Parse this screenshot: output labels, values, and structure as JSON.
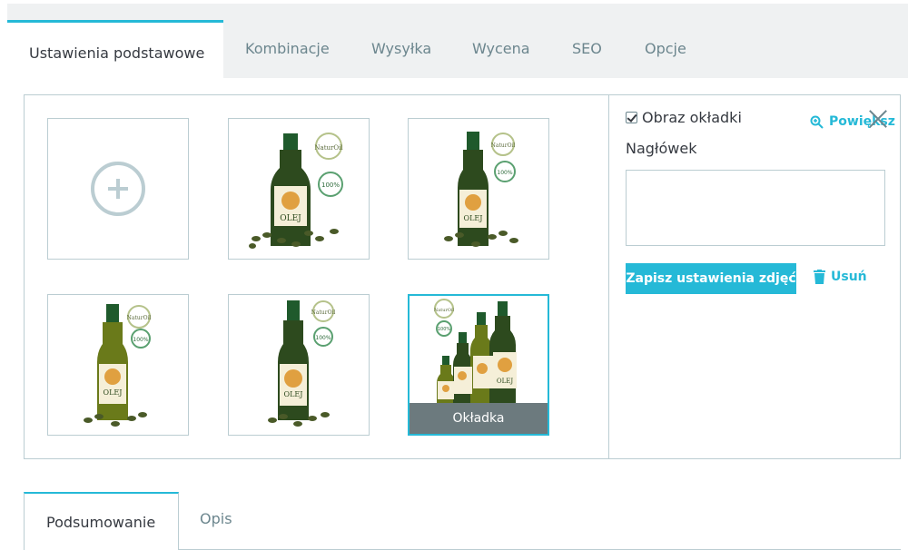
{
  "tabs": {
    "items": [
      {
        "label": "Ustawienia podstawowe",
        "active": true
      },
      {
        "label": "Kombinacje"
      },
      {
        "label": "Wysyłka"
      },
      {
        "label": "Wycena"
      },
      {
        "label": "SEO"
      },
      {
        "label": "Opcje"
      }
    ]
  },
  "images": {
    "add_icon": "plus-circle-icon",
    "cover_label": "Okładka",
    "items": [
      {
        "brand": "NaturOil",
        "badge": "100%",
        "product": "OLEJ"
      },
      {
        "brand": "NaturOil",
        "badge": "100%",
        "product": "OLEJ"
      },
      {
        "brand": "NaturOil",
        "badge": "100%",
        "product": "OLEJ"
      },
      {
        "brand": "NaturOil",
        "badge": "100%",
        "product": "OLEJ"
      },
      {
        "brand": "NaturOil",
        "badge": "100%",
        "product": "OLEJ",
        "cover": true
      }
    ]
  },
  "settings": {
    "cover_checkbox_label": "Obraz okładki",
    "cover_checked": true,
    "zoom_label": "Powiększ",
    "caption_label": "Nagłówek",
    "caption_value": "",
    "save_label": "Zapisz ustawienia zdjęć",
    "delete_label": "Usuń"
  },
  "bottom_tabs": {
    "items": [
      {
        "label": "Podsumowanie",
        "active": true
      },
      {
        "label": "Opis"
      }
    ]
  },
  "colors": {
    "accent": "#25b9d7",
    "border": "#bbcdd2",
    "text": "#363a41",
    "muted": "#6c868e",
    "bottle_green": "#2d5a2a",
    "oil_gold": "#a9a13c"
  }
}
